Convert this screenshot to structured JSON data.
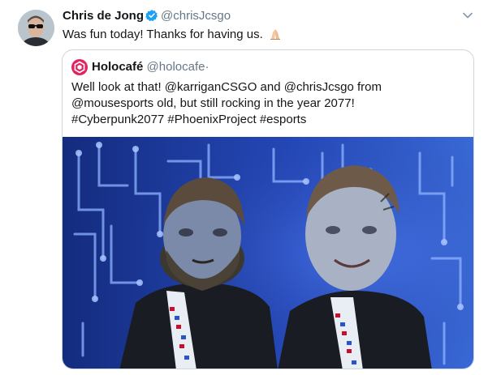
{
  "tweet": {
    "display_name": "Chris de Jong",
    "handle": "@chrisJcsgo",
    "text": "Was fun today! Thanks for having us.",
    "icons": {
      "verified": "verified-badge-icon",
      "more": "chevron-down-icon",
      "emoji": "folded-hands-emoji"
    }
  },
  "quote": {
    "display_name": "Holocafé",
    "handle": "@holocafe",
    "separator": "·",
    "lines": [
      "Well look at that! @karriganCSGO and @chrisJcsgo from",
      "@mousesports old, but still rocking in the year 2077!",
      "#Cyberpunk2077 #PhoenixProject #esports"
    ]
  },
  "colors": {
    "verified": "#1da1f2",
    "holocafe_brand": "#e0245e",
    "photo_bg": "#1d3fa8"
  }
}
